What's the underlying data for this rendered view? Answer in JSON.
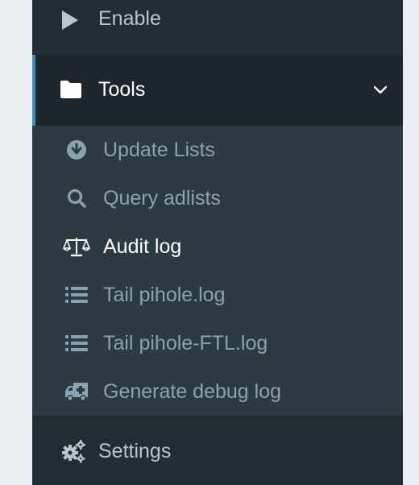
{
  "sidebar": {
    "enable": {
      "label": "Enable",
      "icon": "play-icon"
    },
    "tools": {
      "label": "Tools",
      "icon": "folder-icon",
      "expanded": true
    },
    "tools_items": [
      {
        "label": "Update Lists",
        "icon": "arrow-circle-down-icon"
      },
      {
        "label": "Query adlists",
        "icon": "search-icon"
      },
      {
        "label": "Audit log",
        "icon": "balance-scale-icon",
        "active": true
      },
      {
        "label": "Tail pihole.log",
        "icon": "list-icon"
      },
      {
        "label": "Tail pihole-FTL.log",
        "icon": "list-icon"
      },
      {
        "label": "Generate debug log",
        "icon": "ambulance-icon"
      }
    ],
    "settings": {
      "label": "Settings",
      "icon": "gears-icon"
    }
  },
  "colors": {
    "sidebar_bg": "#222d32",
    "submenu_bg": "#2c3b41",
    "active_bg": "#1e282c",
    "accent": "#3c8dbc",
    "text": "#b8c7ce",
    "sub_text": "#8aa4af",
    "active_text": "#ffffff"
  }
}
